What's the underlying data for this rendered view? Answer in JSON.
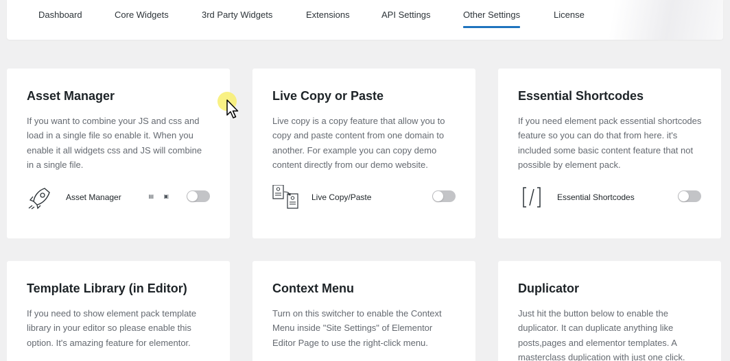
{
  "tabs": [
    {
      "label": "Dashboard"
    },
    {
      "label": "Core Widgets"
    },
    {
      "label": "3rd Party Widgets"
    },
    {
      "label": "Extensions"
    },
    {
      "label": "API Settings"
    },
    {
      "label": "Other Settings",
      "active": true
    },
    {
      "label": "License"
    }
  ],
  "colors": {
    "accent": "#1e73be",
    "background": "#f0f0f1",
    "toggle_off": "#c3c4c7"
  },
  "cards": [
    {
      "title": "Asset Manager",
      "description": "If you want to combine your JS and css and load in a single file so enable it. When you enable it all widgets css and JS will combine in a single file.",
      "feature_label": "Asset Manager",
      "feature_icon": "rocket-icon",
      "enabled": false
    },
    {
      "title": "Live Copy or Paste",
      "description": "Live copy is a copy feature that allow you to copy and paste content from one domain to another. For example you can copy demo content directly from our demo website.",
      "feature_label": "Live Copy/Paste",
      "feature_icon": "copy-paste-icon",
      "enabled": false
    },
    {
      "title": "Essential Shortcodes",
      "description": "If you need element pack essential shortcodes feature so you can do that from here. it's included some basic content feature that not possible by element pack.",
      "feature_label": "Essential Shortcodes",
      "feature_icon": "shortcode-icon",
      "enabled": false
    },
    {
      "title": "Template Library (in Editor)",
      "description": "If you need to show element pack template library in your editor so please enable this option. It's amazing feature for elementor."
    },
    {
      "title": "Context Menu",
      "description": "Turn on this switcher to enable the Context Menu inside \"Site Settings\" of Elementor Editor Page to use the right-click menu."
    },
    {
      "title": "Duplicator",
      "description": "Just hit the button below to enable the duplicator. It can duplicate anything like posts,pages and elementor templates. A masterclass duplication with just one click."
    }
  ]
}
